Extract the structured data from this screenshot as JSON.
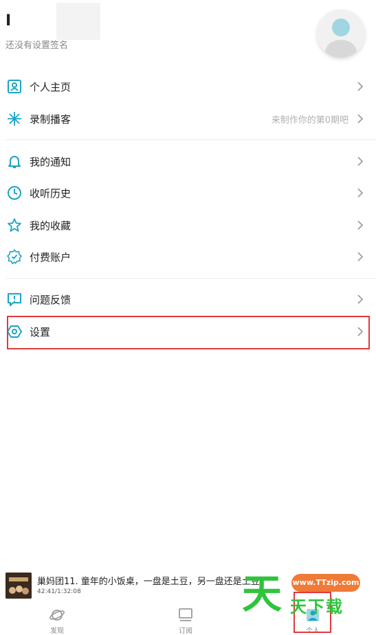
{
  "profile": {
    "name": "I",
    "signature": "还没有设置签名"
  },
  "menu": {
    "items": [
      {
        "label": "个人主页",
        "hint": ""
      },
      {
        "label": "录制播客",
        "hint": "来制作你的第0期吧"
      },
      {
        "label": "我的通知",
        "hint": ""
      },
      {
        "label": "收听历史",
        "hint": ""
      },
      {
        "label": "我的收藏",
        "hint": ""
      },
      {
        "label": "付费账户",
        "hint": ""
      },
      {
        "label": "问题反馈",
        "hint": ""
      },
      {
        "label": "设置",
        "hint": ""
      }
    ]
  },
  "player": {
    "title": "巢妈团11. 童年的小饭桌，一盘是土豆，另一盘还是土豆",
    "time": "42:41/1:32:08"
  },
  "tabs": [
    {
      "label": "发现",
      "icon": "planet-icon"
    },
    {
      "label": "订阅",
      "icon": "monitor-icon"
    },
    {
      "label": "个人",
      "icon": "person-icon"
    }
  ],
  "watermark": {
    "big": "天",
    "pill": "www.TTzip.com",
    "small": "天下载"
  },
  "colors": {
    "accent": "#1aa3c6",
    "highlight": "#e0393b"
  }
}
